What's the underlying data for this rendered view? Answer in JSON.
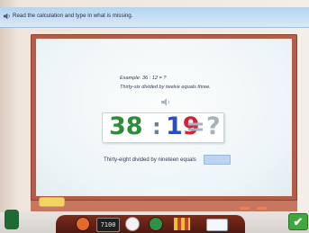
{
  "instruction": {
    "text": "Read the calculation and type in what is missing."
  },
  "board": {
    "example_line": "Example: 36 : 12 = ?",
    "example_description": "Thirty-six divided by twelve equals three.",
    "equation": {
      "dividend": "38",
      "operator": ":",
      "divisor_first_digit": "1",
      "divisor_second_digit": "9",
      "equals": "=",
      "missing": "?"
    },
    "question_text": "Thirty-eight divided by nineteen equals",
    "answer_value": ""
  },
  "toolbar": {
    "clock_text": "7100"
  },
  "colors": {
    "dividend": "#2e8b3a",
    "divisor": "#2a4ec2",
    "divisor_highlight": "#d2213a",
    "board_frame": "#b35d48",
    "answer_box": "#bcd4f0",
    "next_button": "#3fa83c"
  },
  "icons": {
    "instruction_speaker": "speaker-icon",
    "example_speaker": "speaker-icon",
    "next": "checkmark-icon"
  }
}
